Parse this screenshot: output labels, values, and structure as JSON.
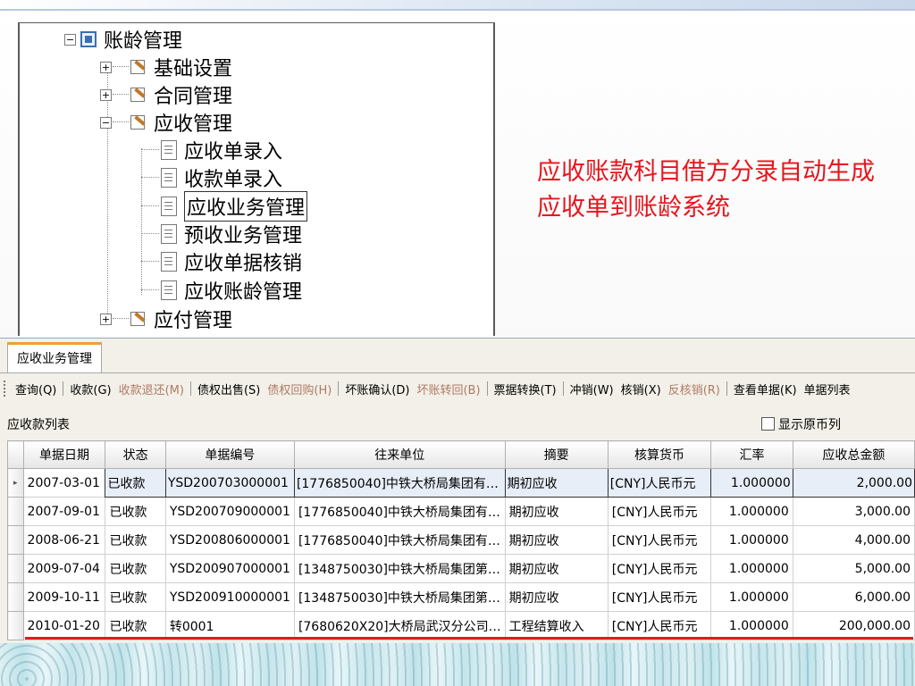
{
  "tree": {
    "root": "账龄管理",
    "items": [
      "基础设置",
      "合同管理",
      "应收管理"
    ],
    "children": [
      "应收单录入",
      "收款单录入",
      "应收业务管理",
      "预收业务管理",
      "应收单据核销",
      "应收账龄管理"
    ],
    "after": "应付管理",
    "expanders": {
      "collapsed": "+",
      "expanded": "−"
    }
  },
  "caption": "应收账款科目借方分录自动生成应收单到账龄系统",
  "tab": "应收业务管理",
  "toolbar": [
    "查询(Q)",
    "收款(G)",
    "收款退还(M)",
    "债权出售(S)",
    "债权回购(H)",
    "坏账确认(D)",
    "坏账转回(B)",
    "票据转换(T)",
    "冲销(W)",
    "核销(X)",
    "反核销(R)",
    "查看单据(K)",
    "单据列表"
  ],
  "list": {
    "title": "应收款列表",
    "show_original": "显示原币列"
  },
  "grid": {
    "headers": [
      "单据日期",
      "状态",
      "单据编号",
      "往来单位",
      "摘要",
      "核算货币",
      "汇率",
      "应收总金额"
    ],
    "rows": [
      [
        "2007-03-01",
        "已收款",
        "YSD200703000001",
        "[1776850040]中铁大桥局集团有…",
        "期初应收",
        "[CNY]人民币元",
        "1.000000",
        "2,000.00"
      ],
      [
        "2007-09-01",
        "已收款",
        "YSD200709000001",
        "[1776850040]中铁大桥局集团有…",
        "期初应收",
        "[CNY]人民币元",
        "1.000000",
        "3,000.00"
      ],
      [
        "2008-06-21",
        "已收款",
        "YSD200806000001",
        "[1776850040]中铁大桥局集团有…",
        "期初应收",
        "[CNY]人民币元",
        "1.000000",
        "4,000.00"
      ],
      [
        "2009-07-04",
        "已收款",
        "YSD200907000001",
        "[1348750030]中铁大桥局集团第…",
        "期初应收",
        "[CNY]人民币元",
        "1.000000",
        "5,000.00"
      ],
      [
        "2009-10-11",
        "已收款",
        "YSD200910000001",
        "[1348750030]中铁大桥局集团第…",
        "期初应收",
        "[CNY]人民币元",
        "1.000000",
        "6,000.00"
      ],
      [
        "2010-01-20",
        "已收款",
        "转0001",
        "[7680620X20]大桥局武汉分公司…",
        "工程结算收入",
        "[CNY]人民币元",
        "1.000000",
        "200,000.00"
      ]
    ],
    "current_row_marker": "▸"
  }
}
